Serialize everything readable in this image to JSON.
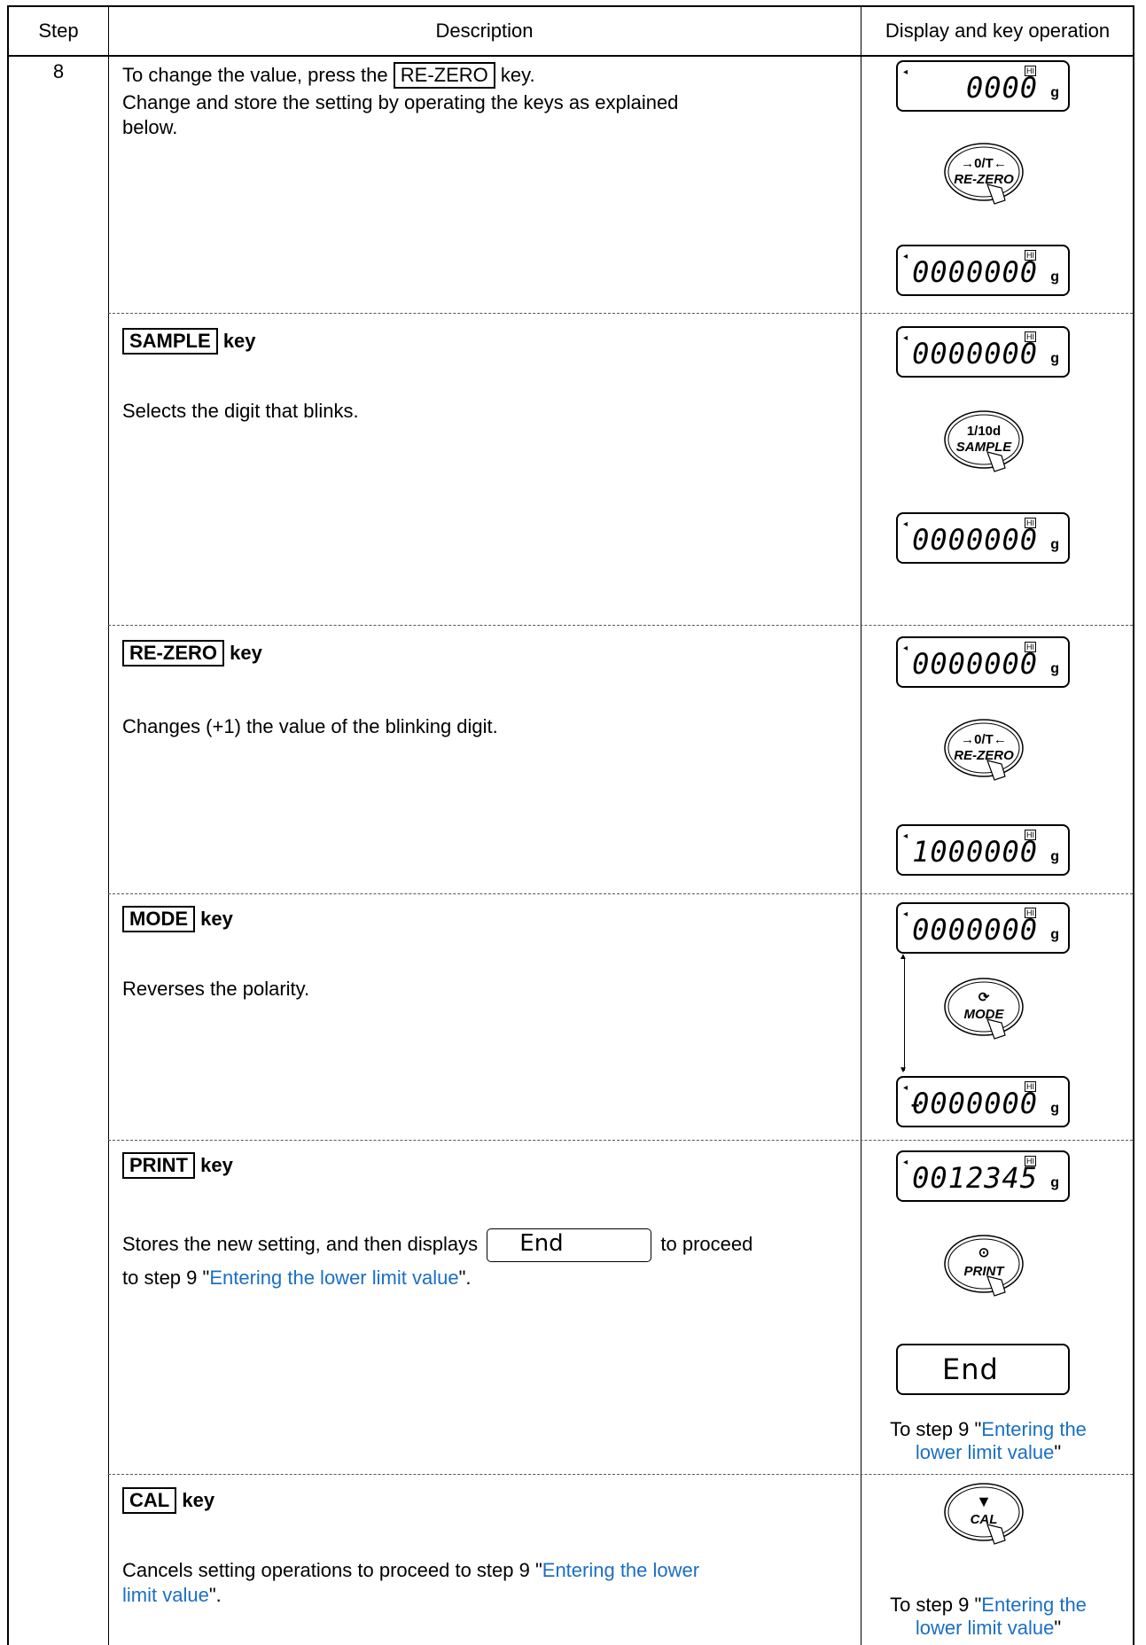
{
  "header": {
    "col_step": "Step",
    "col_desc": "Description",
    "col_display": "Display and key operation"
  },
  "step_number": "8",
  "intro": {
    "line1_pre": "To change the value, press the",
    "line1_key": "RE-ZERO",
    "line1_post": "key.",
    "line2": "Change and store the setting by operating the keys as explained",
    "line3": "below."
  },
  "rows": {
    "sample": {
      "key": "SAMPLE",
      "suffix": "key",
      "text": "Selects the digit that blinks."
    },
    "rezero": {
      "key": "RE-ZERO",
      "suffix": "key",
      "text": "Changes (+1) the value of the blinking digit."
    },
    "mode": {
      "key": "MODE",
      "suffix": "key",
      "text": "Reverses the polarity."
    },
    "print": {
      "key": "PRINT",
      "suffix": "key",
      "text_pre": "Stores the new setting, and then displays",
      "end_label": "End",
      "text_post": "to proceed",
      "line2_pre": "to step 9 \"",
      "line2_link": "Entering the lower limit value",
      "line2_post": "\"."
    },
    "cal": {
      "key": "CAL",
      "suffix": "key",
      "line1_pre": "Cancels setting operations to proceed to step 9 \"",
      "line1_link": "Entering the lower",
      "line2_link": "limit value",
      "line2_post": "\"."
    }
  },
  "displays": {
    "d1": "0000",
    "d2": "0000000",
    "d3": "0000000",
    "d4": "0000000",
    "d5": "0000000",
    "d6": "1000000",
    "d7": "0000000",
    "d8": "0000000",
    "d8_sign": "-",
    "d9": "0012345",
    "end": "End",
    "unit": "g",
    "hi": "HI"
  },
  "keys": {
    "rezero_sym": "→0/T←",
    "rezero_label": "RE-ZERO",
    "sample_sym": "1/10d",
    "sample_label": "SAMPLE",
    "mode_sym": "⟳",
    "mode_label": "MODE",
    "print_sym": "⊙",
    "print_label": "PRINT",
    "cal_sym": "▼",
    "cal_label": "CAL"
  },
  "captions": {
    "pre": "To step 9 \"",
    "link1": "Entering the",
    "link2": "lower limit value",
    "post": "\""
  }
}
